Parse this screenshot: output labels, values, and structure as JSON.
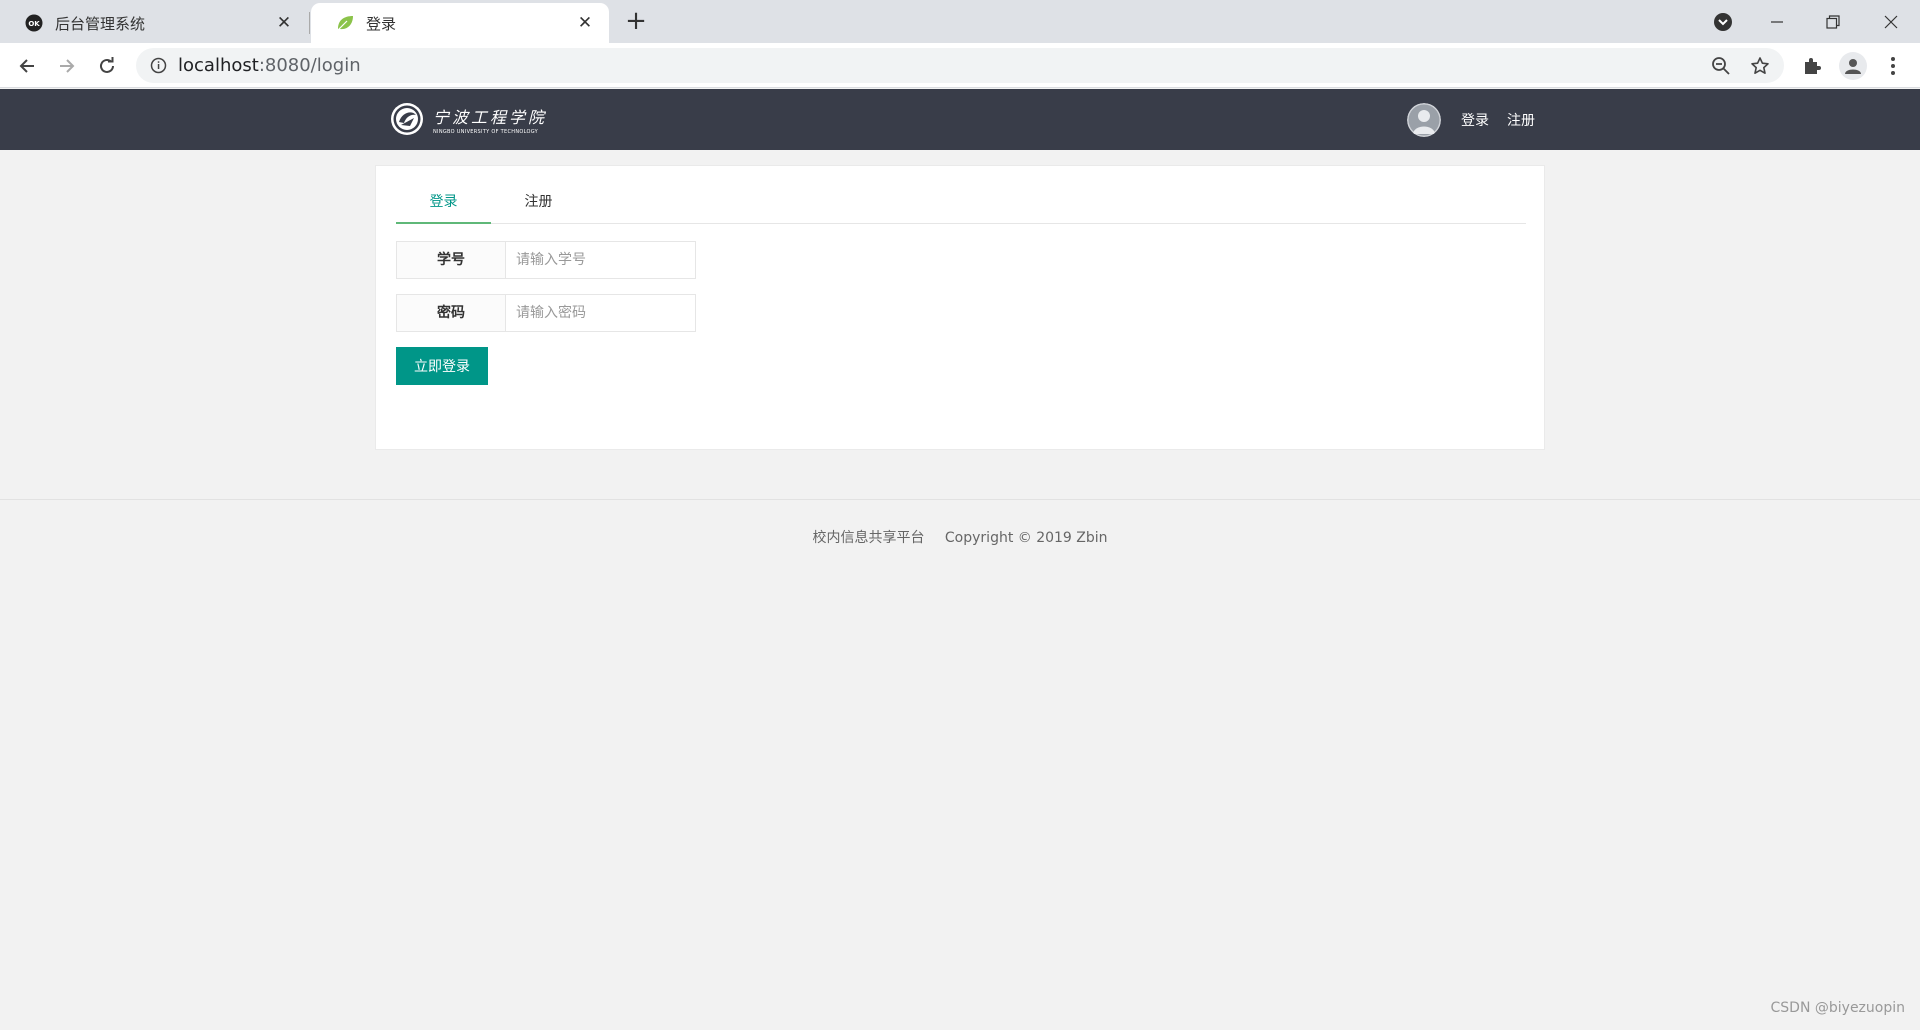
{
  "browser": {
    "tabs": [
      {
        "title": "后台管理系统",
        "icon": "ok-icon"
      },
      {
        "title": "登录",
        "icon": "leaf-icon"
      }
    ],
    "url_host": "localhost",
    "url_rest": ":8080/login"
  },
  "header": {
    "logo_cn": "宁波工程学院",
    "logo_en": "NINGBO UNIVERSITY OF TECHNOLOGY",
    "login_link": "登录",
    "register_link": "注册"
  },
  "card": {
    "tabs": [
      {
        "label": "登录",
        "active": true
      },
      {
        "label": "注册",
        "active": false
      }
    ],
    "fields": [
      {
        "label": "学号",
        "placeholder": "请输入学号",
        "value": ""
      },
      {
        "label": "密码",
        "placeholder": "请输入密码",
        "value": ""
      }
    ],
    "submit_label": "立即登录"
  },
  "footer": {
    "site_name": "校内信息共享平台",
    "copyright": "Copyright  © 2019 Zbin"
  },
  "watermark": "CSDN @biyezuopin",
  "colors": {
    "header_bg": "#393d49",
    "accent": "#009688",
    "tab_underline": "#5fb878",
    "page_bg": "#f2f2f2"
  }
}
